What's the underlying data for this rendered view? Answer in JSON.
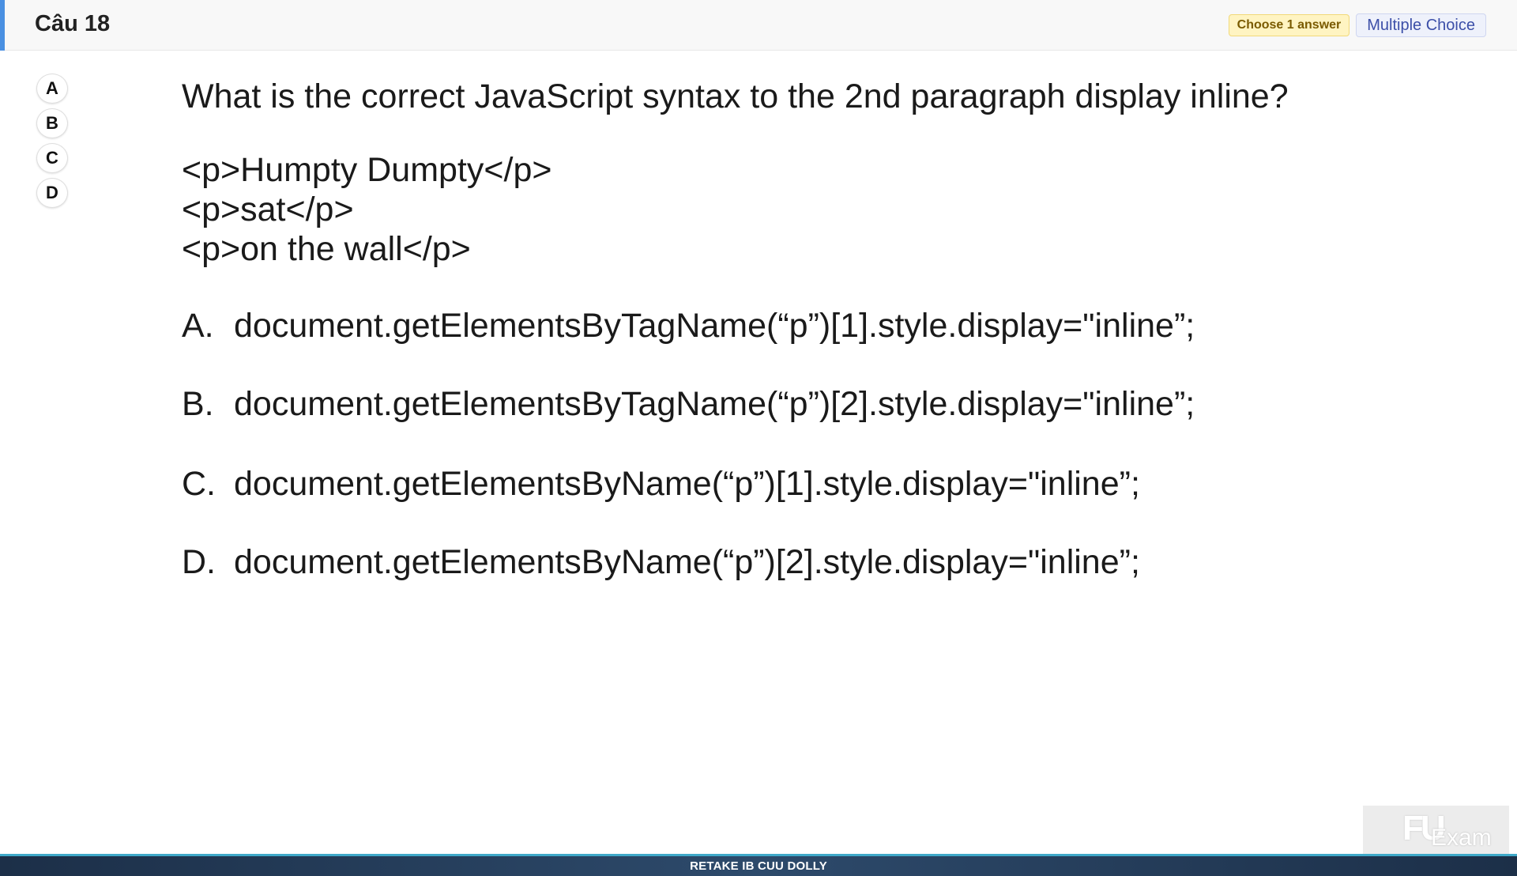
{
  "header": {
    "title": "Câu 18",
    "badge_choose": "Choose 1 answer",
    "badge_type": "Multiple Choice"
  },
  "options": [
    "A",
    "B",
    "C",
    "D"
  ],
  "question": {
    "text": "What is the correct JavaScript syntax to the 2nd paragraph display inline?",
    "code_lines": [
      "<p>Humpty Dumpty</p>",
      "<p>sat</p>",
      "<p>on the wall</p>"
    ],
    "choices": [
      {
        "label": "A.",
        "text": "document.getElementsByTagName(“p”)[1].style.display=\"inline”;"
      },
      {
        "label": "B.",
        "text": "document.getElementsByTagName(“p”)[2].style.display=\"inline”;"
      },
      {
        "label": "C.",
        "text": "document.getElementsByName(“p”)[1].style.display=\"inline”;"
      },
      {
        "label": "D.",
        "text": "document.getElementsByName(“p”)[2].style.display=\"inline”;"
      }
    ]
  },
  "watermark": {
    "logo": "FU",
    "text": "Exam"
  },
  "footer": {
    "text": "RETAKE IB CUU DOLLY"
  },
  "colors": {
    "accent": "#4a90e2",
    "footer_bg": "#2d4a6b",
    "badge_choose_bg": "#fff4c2",
    "badge_type_text": "#3c4fa8"
  }
}
